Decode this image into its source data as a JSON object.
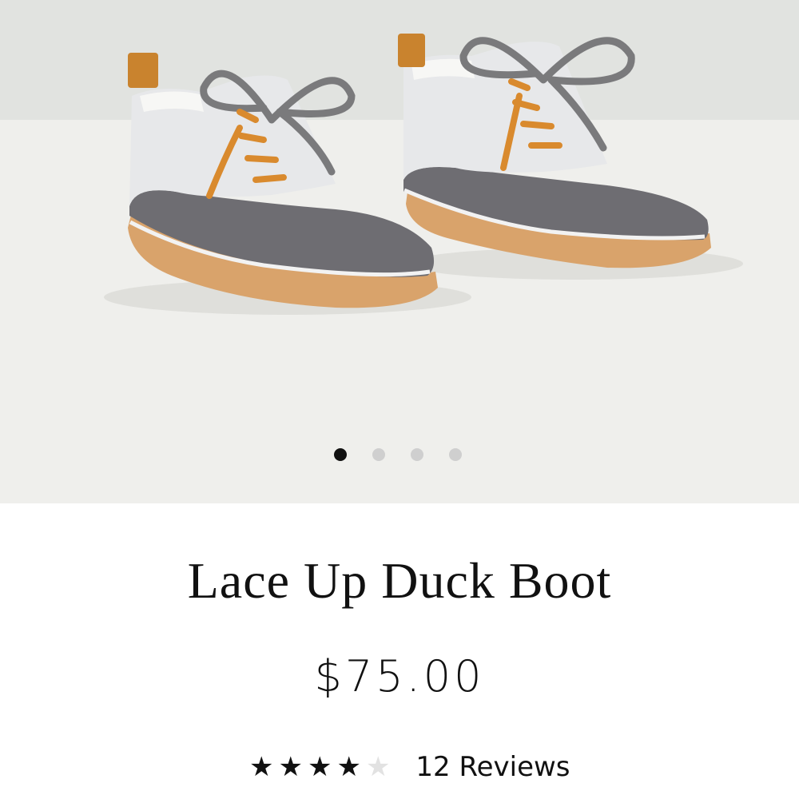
{
  "product": {
    "title": "Lace Up Duck Boot",
    "price": "$75.00",
    "rating": 4,
    "rating_max": 5,
    "reviews_label": "12 Reviews"
  },
  "gallery": {
    "image_count": 4,
    "active_index": 0
  },
  "colors": {
    "boot_upper": "#e7e8ea",
    "boot_rubber": "#6e6d72",
    "sole": "#d9a36b",
    "lace_tips": "#d98a2e",
    "star_filled": "#111111",
    "star_empty": "#e2e2e2",
    "dot_active": "#111111",
    "dot_inactive": "#cfcfcf"
  }
}
